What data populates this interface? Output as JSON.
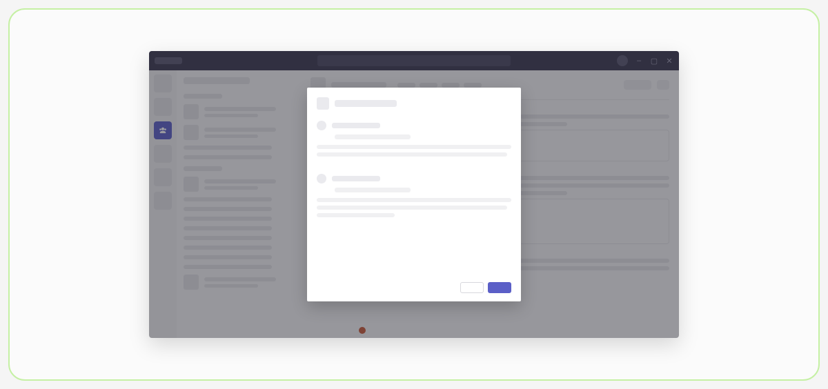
{
  "colors": {
    "accent": "#5b5fc7",
    "titlebar": "#3a3850",
    "border_green": "#c5f0a4"
  },
  "titlebar": {
    "app_label": "",
    "search_placeholder": "",
    "controls": {
      "minimize": "–",
      "maximize": "▢",
      "close": "✕"
    }
  },
  "rail": {
    "items": [
      {
        "name": "activity",
        "active": false
      },
      {
        "name": "chat",
        "active": false
      },
      {
        "name": "teams",
        "active": true
      },
      {
        "name": "calendar",
        "active": false
      },
      {
        "name": "calls",
        "active": false
      },
      {
        "name": "files",
        "active": false
      }
    ]
  },
  "sidebar": {
    "title": "",
    "sections": [
      {
        "label": "",
        "items": [
          {
            "title": "",
            "subtitle": ""
          },
          {
            "title": "",
            "subtitle": ""
          }
        ],
        "lines": [
          "",
          ""
        ]
      },
      {
        "label": "",
        "items": [
          {
            "title": "",
            "subtitle": ""
          }
        ],
        "lines": [
          "",
          "",
          "",
          "",
          "",
          "",
          "",
          ""
        ]
      },
      {
        "label": "",
        "items": [
          {
            "title": "",
            "subtitle": ""
          }
        ]
      }
    ]
  },
  "main": {
    "header": {
      "title": "",
      "tabs": [
        "",
        "",
        "",
        ""
      ],
      "action_label": ""
    },
    "posts": [
      {
        "author": "",
        "lines": [
          "",
          "",
          ""
        ],
        "card": true
      },
      {
        "author": "",
        "lines": [
          "",
          "",
          "",
          ""
        ],
        "card": true
      },
      {
        "author": "",
        "lines": [
          "",
          ""
        ]
      }
    ]
  },
  "modal": {
    "title": "",
    "options": [
      {
        "name": "",
        "subtitle": "",
        "description_lines": [
          "",
          "",
          ""
        ]
      },
      {
        "name": "",
        "subtitle": "",
        "description_lines": [
          "",
          "",
          ""
        ]
      }
    ],
    "buttons": {
      "secondary": "",
      "primary": ""
    }
  },
  "notification_dot": true
}
